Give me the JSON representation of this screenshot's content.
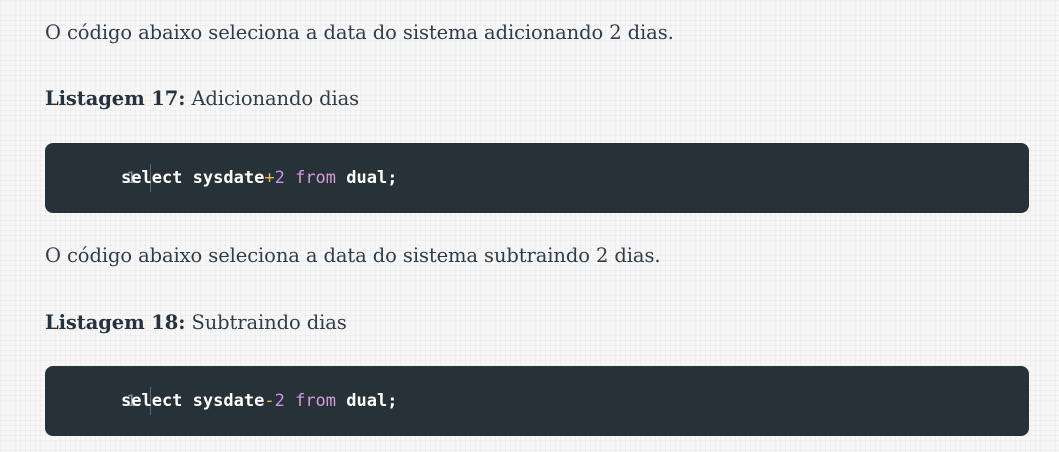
{
  "paragraphs": {
    "intro_add": "O código abaixo seleciona a data do sistema adicionando 2 dias.",
    "intro_sub": "O código abaixo seleciona a data do sistema subtraindo 2 dias."
  },
  "listings": [
    {
      "label": "Listagem 17:",
      "caption": "Adicionando dias",
      "line_number": "1",
      "tokens": {
        "select": "select",
        "sysdate": "sysdate",
        "operator": "+",
        "number": "2",
        "from": "from",
        "table": "dual",
        "terminator": ";"
      }
    },
    {
      "label": "Listagem 18:",
      "caption": "Subtraindo dias",
      "line_number": "1",
      "tokens": {
        "select": "select",
        "sysdate": "sysdate",
        "operator": "-",
        "number": "2",
        "from": "from",
        "table": "dual",
        "terminator": ";"
      }
    }
  ],
  "colors": {
    "code_background": "#263238",
    "operator": "#f3b456",
    "number": "#c792ea",
    "from_keyword": "#d69bd8",
    "body_text": "#2f3d4a"
  }
}
